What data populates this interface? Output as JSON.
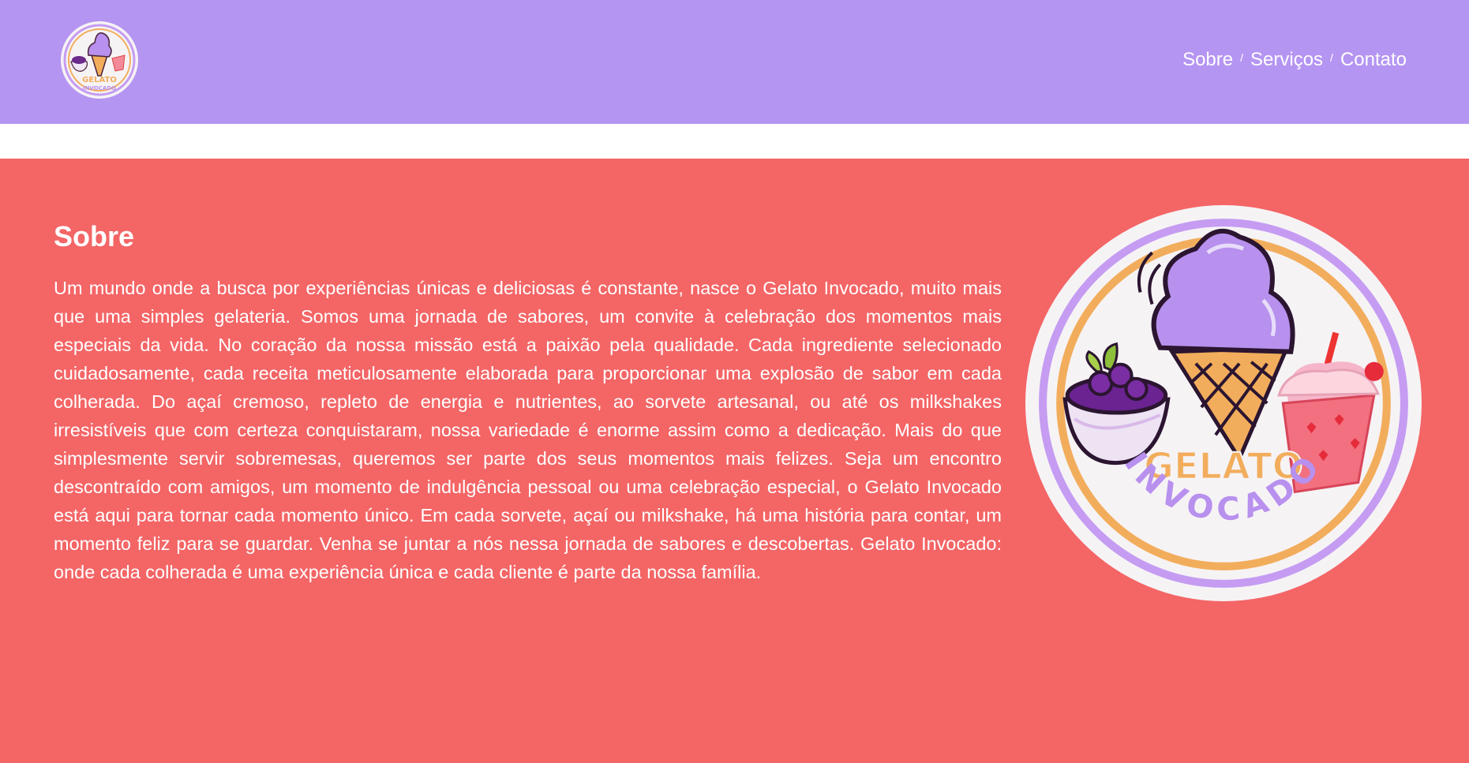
{
  "brand": {
    "logo_line1": "GELATO",
    "logo_line2": "INVOCADO"
  },
  "nav": {
    "items": [
      {
        "label": "Sobre"
      },
      {
        "label": "Serviços"
      },
      {
        "label": "Contato"
      }
    ],
    "separator": "/"
  },
  "about": {
    "title": "Sobre",
    "text": "Um mundo onde a busca por experiências únicas e deliciosas é constante, nasce o Gelato Invocado, muito mais que uma simples gelateria. Somos uma jornada de sabores, um convite à celebração dos momentos mais especiais da vida. No coração da nossa missão está a paixão pela qualidade. Cada ingrediente selecionado cuidadosamente, cada receita meticulosamente elaborada para proporcionar uma explosão de sabor em cada colherada. Do açaí cremoso, repleto de energia e nutrientes, ao sorvete artesanal, ou até os milkshakes irresistíveis que com certeza conquistaram, nossa variedade é enorme assim como a dedicação. Mais do que simplesmente servir sobremesas, queremos ser parte dos seus momentos mais felizes. Seja um encontro descontraído com amigos, um momento de indulgência pessoal ou uma celebração especial, o Gelato Invocado está aqui para tornar cada momento único. Em cada sorvete, açaí ou milkshake, há uma história para contar, um momento feliz para se guardar. Venha se juntar a nós nessa jornada de sabores e descobertas. Gelato Invocado: onde cada colherada é uma experiência única e cada cliente é parte da nossa família."
  },
  "colors": {
    "header_bg": "#b595f2",
    "section_bg": "#f46566",
    "logo_ring_purple": "#c59cf2",
    "logo_ring_orange": "#f2ad5c",
    "ice_cream_purple": "#b890ee"
  },
  "icons": {
    "logo": "gelato-invocado-logo",
    "acai_bowl": "acai-bowl-icon",
    "ice_cream_cone": "ice-cream-cone-icon",
    "milkshake": "milkshake-icon"
  }
}
